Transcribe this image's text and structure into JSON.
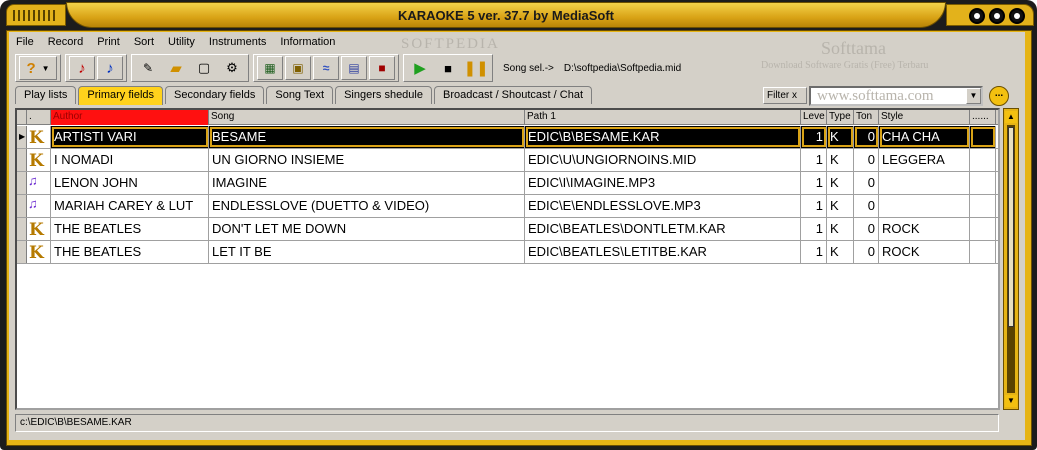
{
  "window": {
    "title": "KARAOKE 5   ver. 37.7 by MediaSoft"
  },
  "menu": [
    {
      "label": "File"
    },
    {
      "label": "Record"
    },
    {
      "label": "Print"
    },
    {
      "label": "Sort"
    },
    {
      "label": "Utility"
    },
    {
      "label": "Instruments"
    },
    {
      "label": "Information"
    }
  ],
  "toolbar": {
    "song_sel_label": "Song sel.->",
    "song_sel_path": "D:\\softpedia\\Softpedia.mid",
    "icons": [
      "question-dropdown-icon",
      "music-note-red-icon",
      "music-note-blue-icon",
      "edit-icon",
      "folder-icon",
      "preview-icon",
      "settings-icon",
      "mixer-icon",
      "image-icon",
      "audio-wave-icon",
      "video-icon",
      "stop-icon",
      "play-icon",
      "stop-square-icon",
      "pause-icon"
    ]
  },
  "watermarks": {
    "softpedia": "SOFTPEDIA",
    "softtama": "Softtama",
    "softtama_sub": "Download Software Gratis (Free) Terbaru",
    "softtama_url": "www.softtama.com"
  },
  "tabs": [
    {
      "label": "Play lists",
      "active": false
    },
    {
      "label": "Primary fields",
      "active": true
    },
    {
      "label": "Secondary fields",
      "active": false
    },
    {
      "label": "Song Text",
      "active": false
    },
    {
      "label": "Singers shedule",
      "active": false
    },
    {
      "label": "Broadcast / Shoutcast / Chat",
      "active": false
    }
  ],
  "filter": {
    "button_label": "Filter x",
    "value": ""
  },
  "more_button": "...",
  "grid": {
    "columns": [
      {
        "key": "indicator",
        "label": ""
      },
      {
        "key": "icon",
        "label": "."
      },
      {
        "key": "author",
        "label": "Author"
      },
      {
        "key": "song",
        "label": "Song"
      },
      {
        "key": "path",
        "label": "Path 1"
      },
      {
        "key": "level",
        "label": "Leve"
      },
      {
        "key": "type",
        "label": "Type"
      },
      {
        "key": "ton",
        "label": "Ton"
      },
      {
        "key": "style",
        "label": "Style"
      },
      {
        "key": "extra",
        "label": "......"
      }
    ],
    "rows": [
      {
        "selected": true,
        "icon": "kar-file-icon",
        "author": "ARTISTI VARI",
        "song": "BESAME",
        "path": "EDIC\\B\\BESAME.KAR",
        "level": "1",
        "type": "K",
        "ton": "0",
        "style": "CHA CHA",
        "extra": ""
      },
      {
        "selected": false,
        "icon": "kar-file-icon",
        "author": "I NOMADI",
        "song": "UN GIORNO INSIEME",
        "path": "EDIC\\U\\UNGIORNOINS.MID",
        "level": "1",
        "type": "K",
        "ton": "0",
        "style": "LEGGERA",
        "extra": ""
      },
      {
        "selected": false,
        "icon": "mp3-file-icon",
        "author": "LENON JOHN",
        "song": "IMAGINE",
        "path": "EDIC\\I\\IMAGINE.MP3",
        "level": "1",
        "type": "K",
        "ton": "0",
        "style": "",
        "extra": ""
      },
      {
        "selected": false,
        "icon": "mp3-file-icon",
        "author": "MARIAH CAREY & LUT",
        "song": "ENDLESSLOVE (DUETTO & VIDEO)",
        "path": "EDIC\\E\\ENDLESSLOVE.MP3",
        "level": "1",
        "type": "K",
        "ton": "0",
        "style": "",
        "extra": ""
      },
      {
        "selected": false,
        "icon": "kar-file-icon",
        "author": "THE BEATLES",
        "song": "DON'T LET ME DOWN",
        "path": "EDIC\\BEATLES\\DONTLETM.KAR",
        "level": "1",
        "type": "K",
        "ton": "0",
        "style": "ROCK",
        "extra": ""
      },
      {
        "selected": false,
        "icon": "kar-file-icon",
        "author": "THE BEATLES",
        "song": "LET IT BE",
        "path": "EDIC\\BEATLES\\LETITBE.KAR",
        "level": "1",
        "type": "K",
        "ton": "0",
        "style": "ROCK",
        "extra": ""
      }
    ]
  },
  "status": {
    "path": "c:\\EDIC\\B\\BESAME.KAR"
  }
}
